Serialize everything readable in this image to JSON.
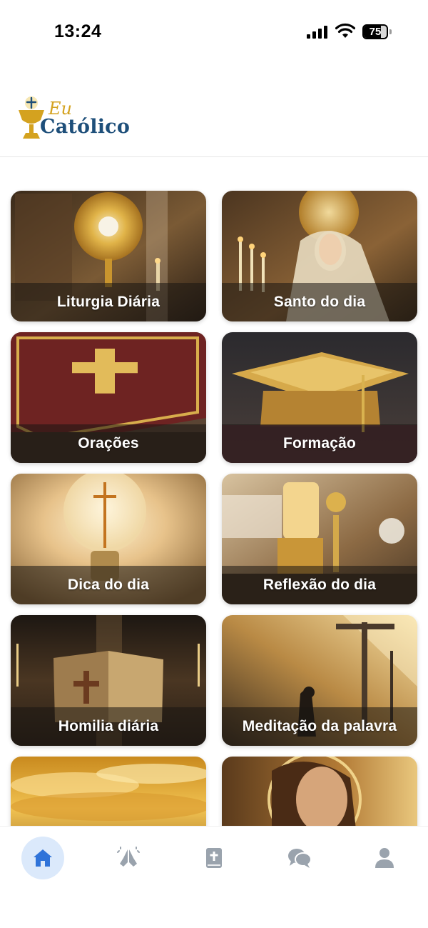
{
  "status_bar": {
    "time": "13:24",
    "battery_level": 75,
    "battery_text": "75"
  },
  "header": {
    "logo_small": "Eu",
    "logo_name": "Católico"
  },
  "cards": [
    {
      "label": "Liturgia Diária"
    },
    {
      "label": "Santo do dia"
    },
    {
      "label": "Orações"
    },
    {
      "label": "Formação"
    },
    {
      "label": "Dica do dia"
    },
    {
      "label": "Reflexão do dia"
    },
    {
      "label": "Homilia diária"
    },
    {
      "label": "Meditação da palavra"
    },
    {
      "label": ""
    },
    {
      "label": ""
    }
  ],
  "bottom_nav": [
    {
      "icon": "home-icon",
      "active": true
    },
    {
      "icon": "praying-hands-icon",
      "active": false
    },
    {
      "icon": "bible-icon",
      "active": false
    },
    {
      "icon": "chat-icon",
      "active": false
    },
    {
      "icon": "profile-icon",
      "active": false
    }
  ],
  "colors": {
    "accent": "#2f73d9",
    "inactive_icon": "#9aa3ad",
    "logo_gold": "#d4a21f",
    "logo_blue": "#1e4f7a",
    "active_pill": "#dbe9fb"
  }
}
